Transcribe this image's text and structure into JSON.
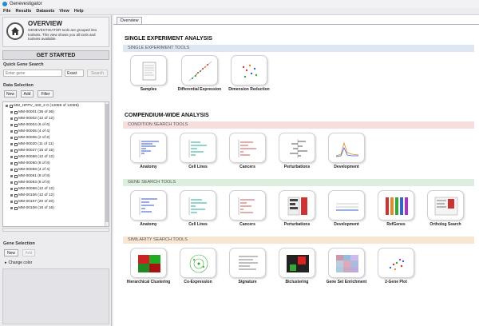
{
  "window": {
    "title": "Genevestigator"
  },
  "menu": [
    "File",
    "Results",
    "Datasets",
    "View",
    "Help"
  ],
  "overview": {
    "title": "OVERVIEW",
    "description": "GENEVESTIGATOR tools are grouped into toolsets. This view shows you all tools and toolsets available."
  },
  "get_started": "GET STARTED",
  "quick_search": {
    "label": "Quick Gene Search",
    "placeholder": "Enter gene",
    "mode": "Exact",
    "button": "Search"
  },
  "data_selection": {
    "label": "Data Selection",
    "buttons": [
      "New",
      "Add",
      "Filter"
    ],
    "root": "MM_HPPV_430_2-0 (12089 of 12089)",
    "items": [
      "MM-00001 (36 of 36)",
      "MM-00002 (12 of 12)",
      "MM-00004 (6 of 6)",
      "MM-00005 (4 of 4)",
      "MM-00006 (2 of 2)",
      "MM-00020 (11 of 11)",
      "MM-00027 (15 of 15)",
      "MM-00058 (12 of 12)",
      "MM-00050 (8 of 8)",
      "MM-00059 (4 of 4)",
      "MM-00061 (8 of 8)",
      "MM-00063 (8 of 8)",
      "MM-00068 (12 of 12)",
      "MM-00106 (12 of 12)",
      "MM-00107 (20 of 20)",
      "MM-00108 (16 of 16)"
    ]
  },
  "gene_selection": {
    "label": "Gene Selection",
    "buttons": [
      "New",
      "Add"
    ],
    "change_color": "Change color"
  },
  "tabs": [
    "Overview"
  ],
  "sections": {
    "single": {
      "title": "SINGLE EXPERIMENT ANALYSIS",
      "band": "SINGLE EXPERIMENT TOOLS",
      "tools": [
        "Samples",
        "Differential Expression",
        "Dimension Reduction"
      ]
    },
    "compendium": {
      "title": "COMPENDIUM-WIDE ANALYSIS",
      "condition_band": "CONDITION SEARCH TOOLS",
      "condition_tools": [
        "Anatomy",
        "Cell Lines",
        "Cancers",
        "Perturbations",
        "Development"
      ],
      "gene_band": "GENE SEARCH TOOLS",
      "gene_tools": [
        "Anatomy",
        "Cell Lines",
        "Cancers",
        "Perturbations",
        "Development",
        "RefGenes",
        "Ortholog Search"
      ],
      "similarity_band": "SIMILARITY SEARCH TOOLS",
      "similarity_tools": [
        "Hierarchical Clustering",
        "Co-Expression",
        "Signature",
        "Biclustering",
        "Gene Set Enrichment",
        "2-Gene Plot"
      ]
    }
  },
  "colors": {
    "band_blue": "#dde6f3",
    "band_pink": "#f6dede",
    "band_green": "#dcefdf",
    "band_orange": "#f7e6d2"
  }
}
